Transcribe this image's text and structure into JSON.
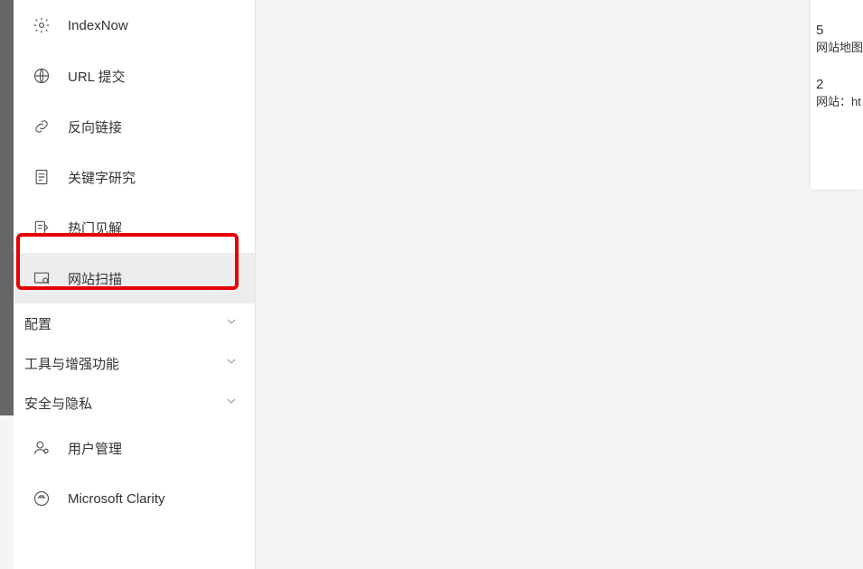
{
  "sidebar": {
    "items": [
      {
        "label": "IndexNow"
      },
      {
        "label": "URL 提交"
      },
      {
        "label": "反向链接"
      },
      {
        "label": "关键字研究"
      },
      {
        "label": "热门见解"
      },
      {
        "label": "网站扫描"
      }
    ],
    "sections": [
      {
        "label": "配置"
      },
      {
        "label": "工具与增强功能"
      },
      {
        "label": "安全与隐私"
      }
    ],
    "bottom": [
      {
        "label": "用户管理"
      },
      {
        "label": "Microsoft Clarity"
      }
    ]
  },
  "right_panel": {
    "entries": [
      {
        "count": "5",
        "label": "网站地图"
      },
      {
        "count": "2",
        "label": "网站：ht"
      }
    ]
  }
}
